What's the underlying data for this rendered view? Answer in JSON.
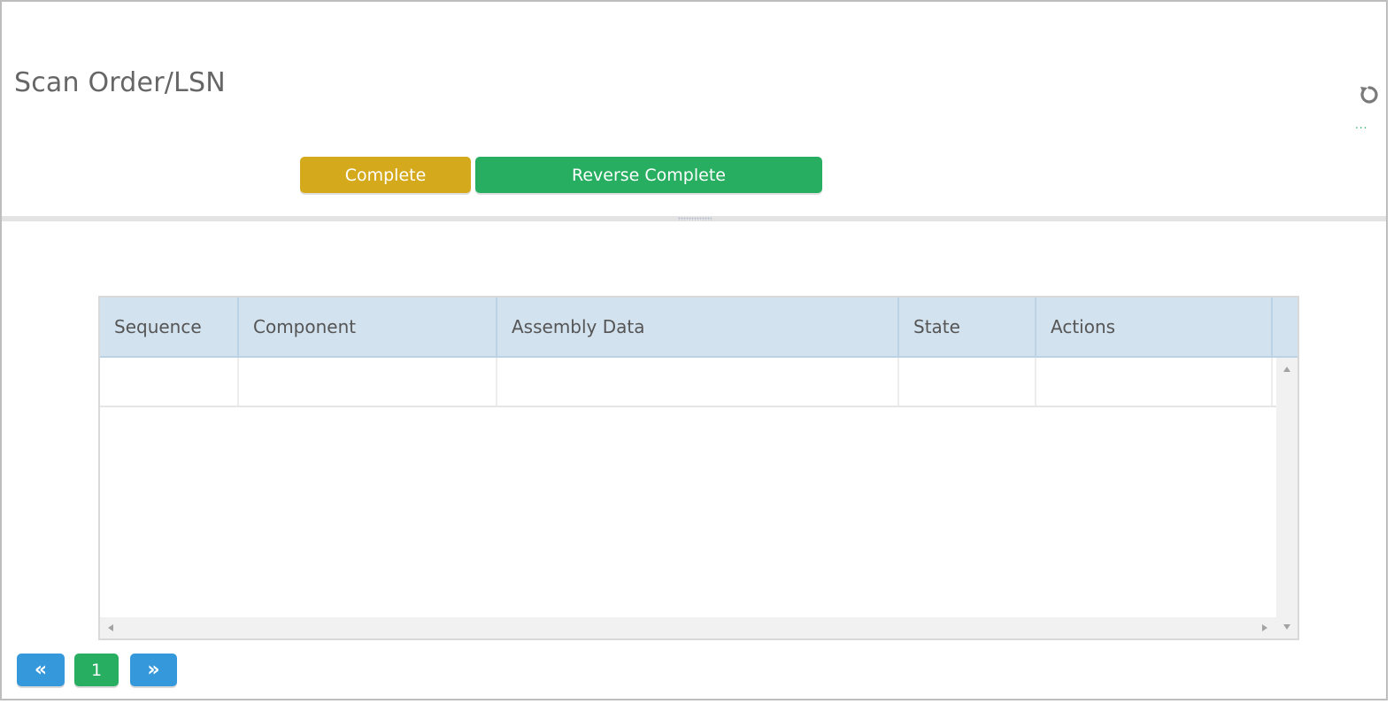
{
  "header": {
    "title": "Scan Order/LSN",
    "more_label": "...",
    "complete_label": "Complete",
    "reverse_complete_label": "Reverse Complete"
  },
  "grid": {
    "columns": [
      "Sequence",
      "Component",
      "Assembly Data",
      "State",
      "Actions"
    ],
    "rows": []
  },
  "pager": {
    "prev_label": "«",
    "current_page": "1",
    "next_label": "»"
  },
  "icons": {
    "refresh": "refresh-icon",
    "prev": "chevron-double-left-icon",
    "next": "chevron-double-right-icon"
  },
  "colors": {
    "complete": "#d4a91c",
    "reverse_complete": "#27ae60",
    "pager_nav": "#3498db",
    "pager_current": "#27ae60",
    "grid_header": "#d3e2ef"
  }
}
